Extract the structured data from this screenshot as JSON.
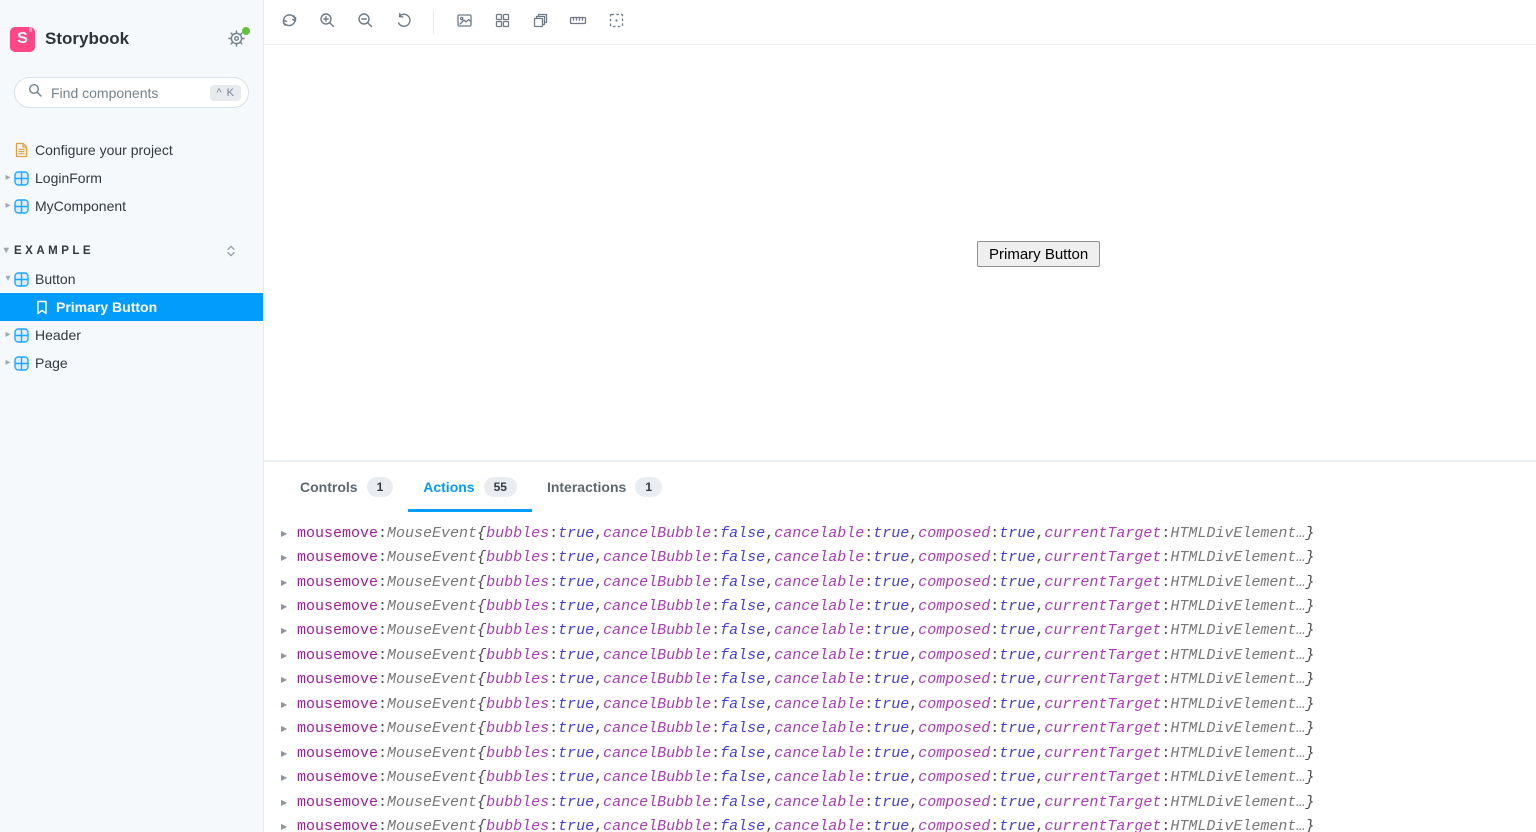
{
  "brand": {
    "title": "Storybook",
    "logo_letter": "S"
  },
  "search": {
    "placeholder": "Find components",
    "shortcut": "^ K"
  },
  "sidebar": {
    "items": [
      {
        "type": "doc",
        "label": "Configure your project"
      },
      {
        "type": "component",
        "label": "LoginForm",
        "state": "collapsed"
      },
      {
        "type": "component",
        "label": "MyComponent",
        "state": "collapsed"
      },
      {
        "type": "section",
        "label": "EXAMPLE",
        "state": "expanded"
      },
      {
        "type": "component",
        "label": "Button",
        "state": "expanded"
      },
      {
        "type": "story",
        "label": "Primary Button",
        "selected": true
      },
      {
        "type": "component",
        "label": "Header",
        "state": "collapsed"
      },
      {
        "type": "component",
        "label": "Page",
        "state": "collapsed"
      }
    ]
  },
  "toolbar": {
    "icons": [
      "remount-icon",
      "zoom-in-icon",
      "zoom-out-icon",
      "reset-zoom-icon",
      "background-icon",
      "grid-icon",
      "viewport-icon",
      "measure-icon",
      "outline-icon"
    ]
  },
  "canvas": {
    "story_button_label": "Primary Button"
  },
  "panel": {
    "tabs": [
      {
        "label": "Controls",
        "badge": "1",
        "active": false
      },
      {
        "label": "Actions",
        "badge": "55",
        "active": true
      },
      {
        "label": "Interactions",
        "badge": "1",
        "active": false
      }
    ],
    "log": {
      "row_count": 13,
      "tokens": [
        {
          "text": "mousemove",
          "style": "name"
        },
        {
          "text": ": ",
          "style": "punct"
        },
        {
          "text": "MouseEvent ",
          "style": "object"
        },
        {
          "text": "{",
          "style": "brace"
        },
        {
          "text": "bubbles",
          "style": "key"
        },
        {
          "text": ": ",
          "style": "punct"
        },
        {
          "text": "true",
          "style": "bool"
        },
        {
          "text": ", ",
          "style": "punct"
        },
        {
          "text": "cancelBubble",
          "style": "key"
        },
        {
          "text": ": ",
          "style": "punct"
        },
        {
          "text": "false",
          "style": "bool"
        },
        {
          "text": ", ",
          "style": "punct"
        },
        {
          "text": "cancelable",
          "style": "key"
        },
        {
          "text": ": ",
          "style": "punct"
        },
        {
          "text": "true",
          "style": "bool"
        },
        {
          "text": ", ",
          "style": "punct"
        },
        {
          "text": "composed",
          "style": "key"
        },
        {
          "text": ": ",
          "style": "punct"
        },
        {
          "text": "true",
          "style": "bool"
        },
        {
          "text": ", ",
          "style": "punct"
        },
        {
          "text": "currentTarget",
          "style": "key"
        },
        {
          "text": ": ",
          "style": "punct"
        },
        {
          "text": "HTMLDivElement…",
          "style": "object"
        },
        {
          "text": "}",
          "style": "brace"
        }
      ]
    }
  },
  "colors": {
    "brand_pink": "#FF4785",
    "selection_blue": "#029CFD",
    "notification_green": "#66BF3C",
    "icon_gray": "#73828C",
    "sidebar_bg": "#F6F9FC"
  },
  "glyphs": {
    "caret_right": "▸",
    "caret_down": "▾",
    "expand_triangle": "▶"
  }
}
